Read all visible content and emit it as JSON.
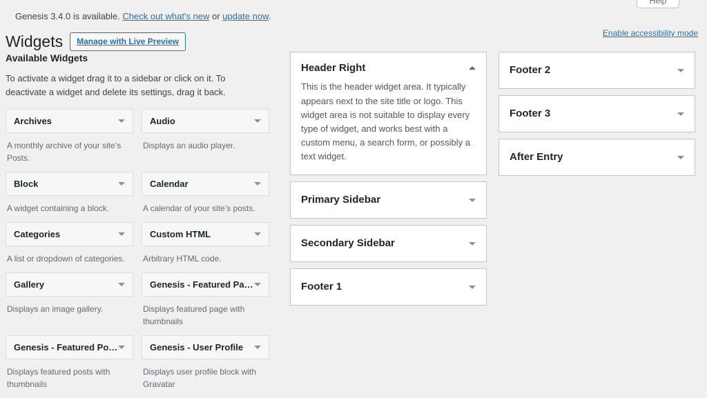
{
  "help_tab": {
    "label": "Help"
  },
  "notice": {
    "text_before": "Genesis 3.4.0 is available. ",
    "link_whats_new": "Check out what's new",
    "text_middle": " or ",
    "link_update": "update now",
    "text_after": "."
  },
  "accessibility": {
    "label": "Enable accessibility mode"
  },
  "header": {
    "page_title": "Widgets",
    "live_preview_button": "Manage with Live Preview"
  },
  "available": {
    "heading": "Available Widgets",
    "intro": "To activate a widget drag it to a sidebar or click on it. To deactivate a widget and delete its settings, drag it back.",
    "chevron_icon": "chevron-down-icon",
    "widgets": [
      {
        "name": "Archives",
        "description": "A monthly archive of your site’s Posts."
      },
      {
        "name": "Audio",
        "description": "Displays an audio player."
      },
      {
        "name": "Block",
        "description": "A widget containing a block."
      },
      {
        "name": "Calendar",
        "description": "A calendar of your site’s posts."
      },
      {
        "name": "Categories",
        "description": "A list or dropdown of categories."
      },
      {
        "name": "Custom HTML",
        "description": "Arbitrary HTML code."
      },
      {
        "name": "Gallery",
        "description": "Displays an image gallery."
      },
      {
        "name": "Genesis - Featured Page",
        "description": "Displays featured page with thumbnails"
      },
      {
        "name": "Genesis - Featured Posts",
        "description": "Displays featured posts with thumbnails"
      },
      {
        "name": "Genesis - User Profile",
        "description": "Displays user profile block with Gravatar"
      }
    ]
  },
  "sidebars": {
    "column_left": [
      {
        "title": "Header Right",
        "expanded": true,
        "toggle_icon": "chevron-up-icon",
        "description": "This is the header widget area. It typically appears next to the site title or logo. This widget area is not suitable to display every type of widget, and works best with a custom menu, a search form, or possibly a text widget."
      },
      {
        "title": "Primary Sidebar",
        "expanded": false,
        "toggle_icon": "chevron-down-icon",
        "description": ""
      },
      {
        "title": "Secondary Sidebar",
        "expanded": false,
        "toggle_icon": "chevron-down-icon",
        "description": ""
      },
      {
        "title": "Footer 1",
        "expanded": false,
        "toggle_icon": "chevron-down-icon",
        "description": ""
      }
    ],
    "column_right": [
      {
        "title": "Footer 2",
        "expanded": false,
        "toggle_icon": "chevron-down-icon",
        "description": ""
      },
      {
        "title": "Footer 3",
        "expanded": false,
        "toggle_icon": "chevron-down-icon",
        "description": ""
      },
      {
        "title": "After Entry",
        "expanded": false,
        "toggle_icon": "chevron-down-icon",
        "description": ""
      }
    ]
  },
  "colors": {
    "page_background": "#f0f0f1",
    "panel_background": "#ffffff",
    "card_background": "#f6f7f7",
    "link_blue": "#2271b1",
    "text_dark": "#1d2327",
    "text_muted": "#646970",
    "border": "#c3c4c7"
  }
}
